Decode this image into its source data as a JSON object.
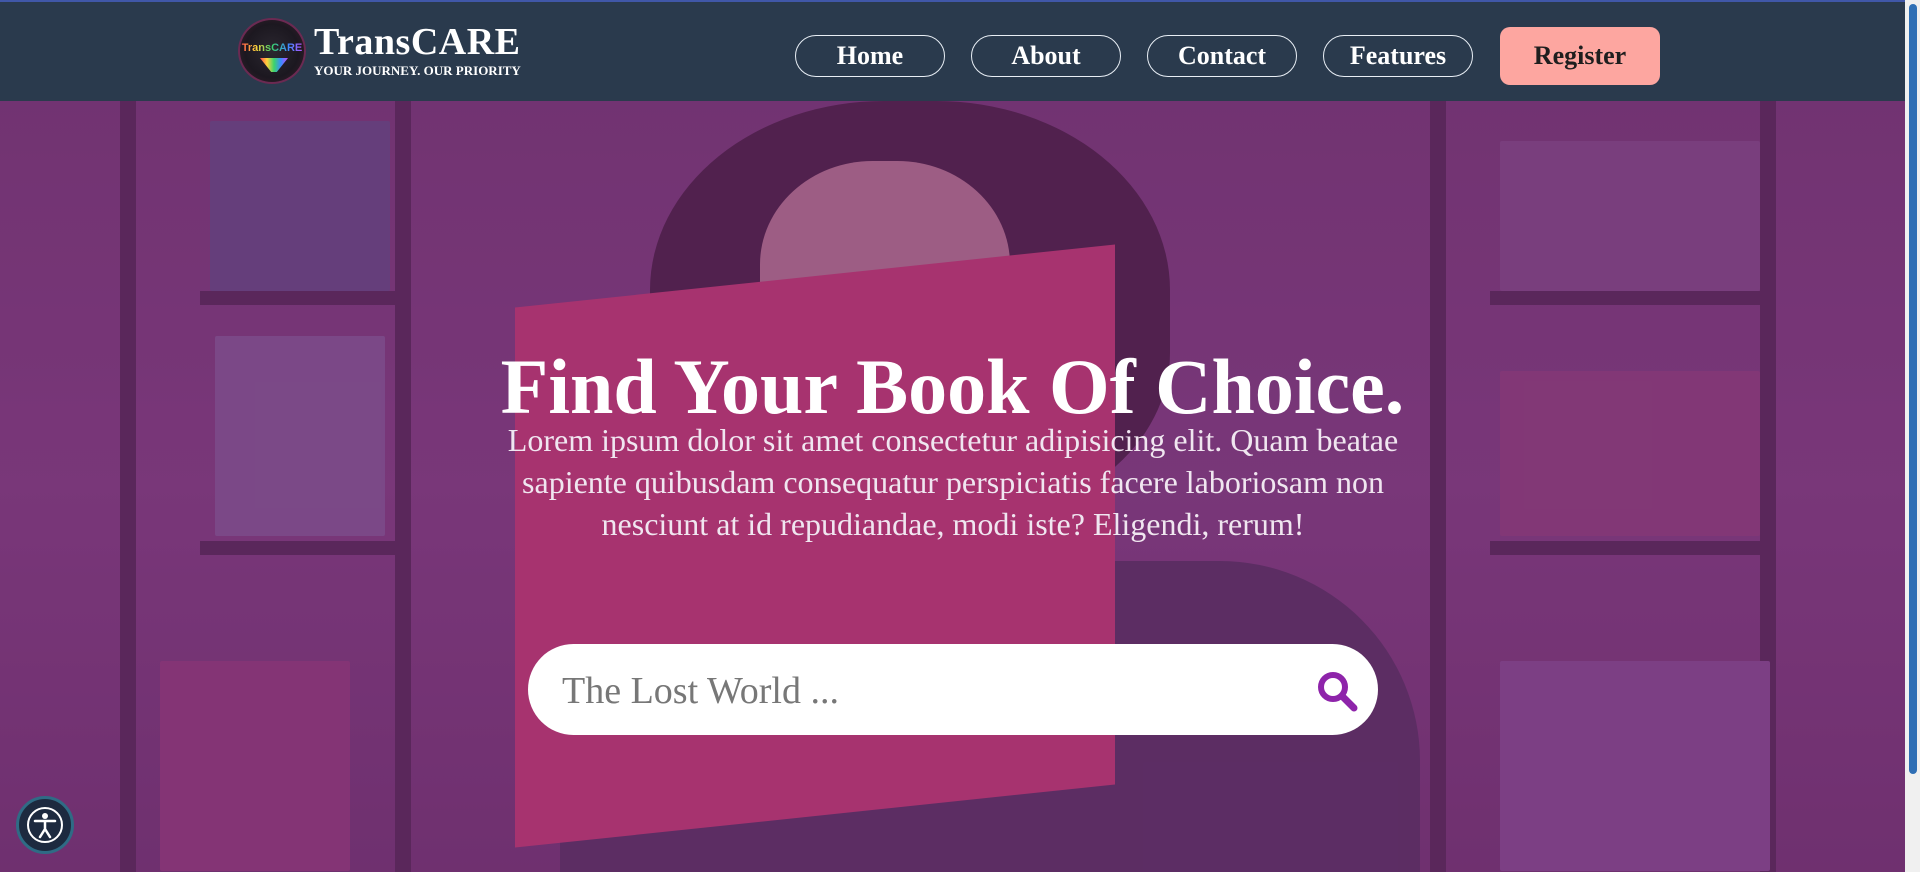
{
  "brand": {
    "logo_text": "TransCARE",
    "name": "TransCARE",
    "tagline": "YOUR JOURNEY. OUR PRIORITY"
  },
  "nav": {
    "items": [
      {
        "label": "Home"
      },
      {
        "label": "About"
      },
      {
        "label": "Contact"
      },
      {
        "label": "Features"
      }
    ],
    "register_label": "Register"
  },
  "hero": {
    "title": "Find Your Book Of Choice.",
    "description": "Lorem ipsum dolor sit amet consectetur adipisicing elit. Quam beatae sapiente quibusdam consequatur perspiciatis facere laboriosam non nesciunt at id repudiandae, modi iste? Eligendi, rerum!"
  },
  "search": {
    "placeholder": "The Lost World ...",
    "icon": "search-icon",
    "icon_color": "#8e24aa"
  },
  "accessibility": {
    "icon": "accessibility-icon"
  },
  "colors": {
    "header_bg": "#2a3a4d",
    "register_bg": "#fda6a0",
    "hero_overlay": "#7a2882"
  }
}
